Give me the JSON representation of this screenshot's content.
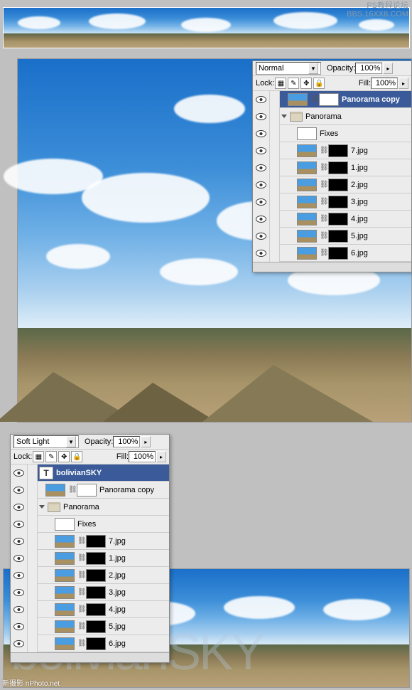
{
  "watermarks": {
    "top1": "PS教程论坛",
    "top2": "BBS.16XX8.COM",
    "bottom": "新摄影 nPhoto.net"
  },
  "panel1": {
    "blend": "Normal",
    "opacity_label": "Opacity:",
    "opacity_val": "100%",
    "lock_label": "Lock:",
    "fill_label": "Fill:",
    "fill_val": "100%",
    "layers": [
      {
        "name": "Panorama copy",
        "sel": true,
        "type": "layer",
        "thumb": "sky-t",
        "mask": "mask",
        "indent": 0
      },
      {
        "name": "Panorama",
        "type": "folder",
        "open": true,
        "indent": 0
      },
      {
        "name": "Fixes",
        "type": "layer",
        "thumb": "mask",
        "indent": 1,
        "nomask": true
      },
      {
        "name": "7.jpg",
        "type": "layer",
        "thumb": "sky-t",
        "mask": "mask-b",
        "indent": 1
      },
      {
        "name": "1.jpg",
        "type": "layer",
        "thumb": "sky-t",
        "mask": "mask-b",
        "indent": 1
      },
      {
        "name": "2.jpg",
        "type": "layer",
        "thumb": "sky-t",
        "mask": "mask-b",
        "indent": 1
      },
      {
        "name": "3.jpg",
        "type": "layer",
        "thumb": "sky-t",
        "mask": "mask-b",
        "indent": 1
      },
      {
        "name": "4.jpg",
        "type": "layer",
        "thumb": "sky-t",
        "mask": "mask-b",
        "indent": 1
      },
      {
        "name": "5.jpg",
        "type": "layer",
        "thumb": "sky-t",
        "mask": "mask-b",
        "indent": 1
      },
      {
        "name": "6.jpg",
        "type": "layer",
        "thumb": "sky-t",
        "mask": "mask-b",
        "indent": 1
      }
    ]
  },
  "panel2": {
    "blend": "Soft Light",
    "opacity_label": "Opacity:",
    "opacity_val": "100%",
    "lock_label": "Lock:",
    "fill_label": "Fill:",
    "fill_val": "100%",
    "layers": [
      {
        "name": "bolivianSKY",
        "sel": true,
        "type": "text",
        "indent": 0
      },
      {
        "name": "Panorama copy",
        "type": "layer",
        "thumb": "sky-t",
        "mask": "mask",
        "indent": 0
      },
      {
        "name": "Panorama",
        "type": "folder",
        "open": true,
        "indent": 0
      },
      {
        "name": "Fixes",
        "type": "layer",
        "thumb": "mask",
        "indent": 1,
        "nomask": true
      },
      {
        "name": "7.jpg",
        "type": "layer",
        "thumb": "sky-t",
        "mask": "mask-b",
        "indent": 1
      },
      {
        "name": "1.jpg",
        "type": "layer",
        "thumb": "sky-t",
        "mask": "mask-b",
        "indent": 1
      },
      {
        "name": "2.jpg",
        "type": "layer",
        "thumb": "sky-t",
        "mask": "mask-b",
        "indent": 1
      },
      {
        "name": "3.jpg",
        "type": "layer",
        "thumb": "sky-t",
        "mask": "mask-b",
        "indent": 1
      },
      {
        "name": "4.jpg",
        "type": "layer",
        "thumb": "sky-t",
        "mask": "mask-b",
        "indent": 1
      },
      {
        "name": "5.jpg",
        "type": "layer",
        "thumb": "sky-t",
        "mask": "mask-b",
        "indent": 1
      },
      {
        "name": "6.jpg",
        "type": "layer",
        "thumb": "sky-t",
        "mask": "mask-b",
        "indent": 1
      }
    ]
  },
  "text_overlay": "bolivianSKY"
}
